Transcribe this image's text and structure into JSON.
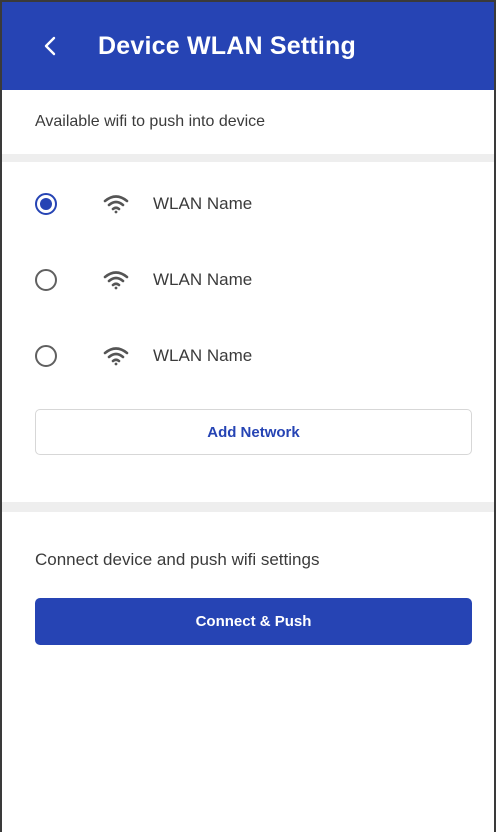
{
  "header": {
    "title": "Device WLAN Setting",
    "back_icon": "chevron-left-icon",
    "color": "#2644b4"
  },
  "wifi_section": {
    "caption": "Available wifi to push into device",
    "items": [
      {
        "name": "WLAN Name",
        "selected": true,
        "icon": "wifi-icon"
      },
      {
        "name": "WLAN Name",
        "selected": false,
        "icon": "wifi-icon"
      },
      {
        "name": "WLAN Name",
        "selected": false,
        "icon": "wifi-icon"
      }
    ],
    "add_network_label": "Add  Network"
  },
  "connect_section": {
    "caption": "Connect device and push wifi settings",
    "button_label": "Connect  & Push"
  },
  "colors": {
    "accent": "#2644b4",
    "band": "#eeeeee",
    "text": "#3b3b3b"
  }
}
